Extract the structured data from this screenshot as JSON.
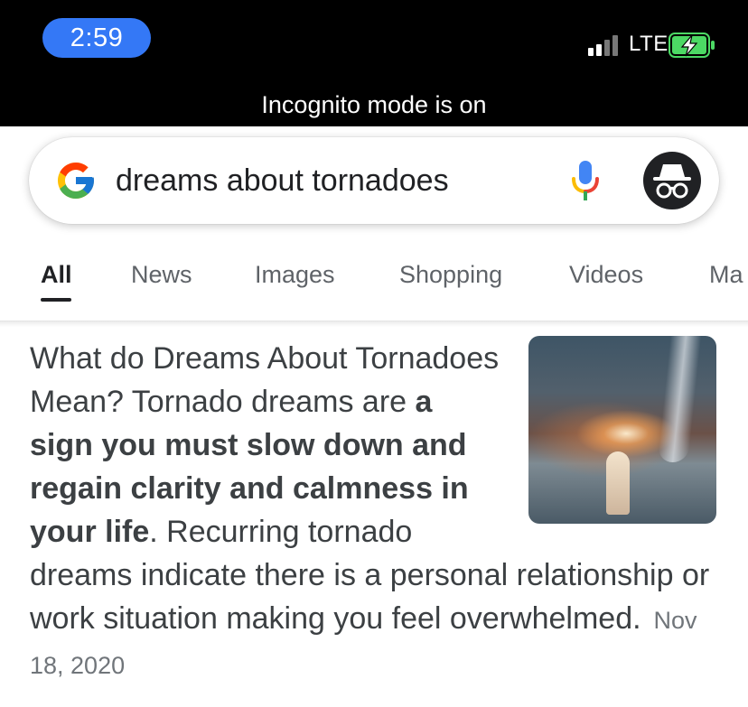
{
  "status_bar": {
    "time": "2:59",
    "network": "LTE",
    "battery_state": "charging",
    "incognito_banner": "Incognito mode is on"
  },
  "search": {
    "query": "dreams about tornadoes",
    "mic_icon": "mic-icon",
    "incognito_icon": "incognito-icon"
  },
  "tabs": [
    {
      "label": "All",
      "active": true
    },
    {
      "label": "News"
    },
    {
      "label": "Images"
    },
    {
      "label": "Shopping"
    },
    {
      "label": "Videos"
    },
    {
      "label": "Ma"
    }
  ],
  "result": {
    "text_pre": "What do Dreams About Tornadoes Mean? Tornado dreams are ",
    "text_bold": "a sign you must slow down and regain clarity and calmness in your life",
    "text_post": ". Recurring tornado dreams indicate there is a personal relationship or work situation making you feel overwhelmed.",
    "date": "Nov 18, 2020",
    "thumbnail_icon": "tornado-image"
  },
  "colors": {
    "status_bg": "#000000",
    "time_pill": "#3478f6",
    "battery_green": "#4cd964",
    "text": "#3c4043"
  }
}
